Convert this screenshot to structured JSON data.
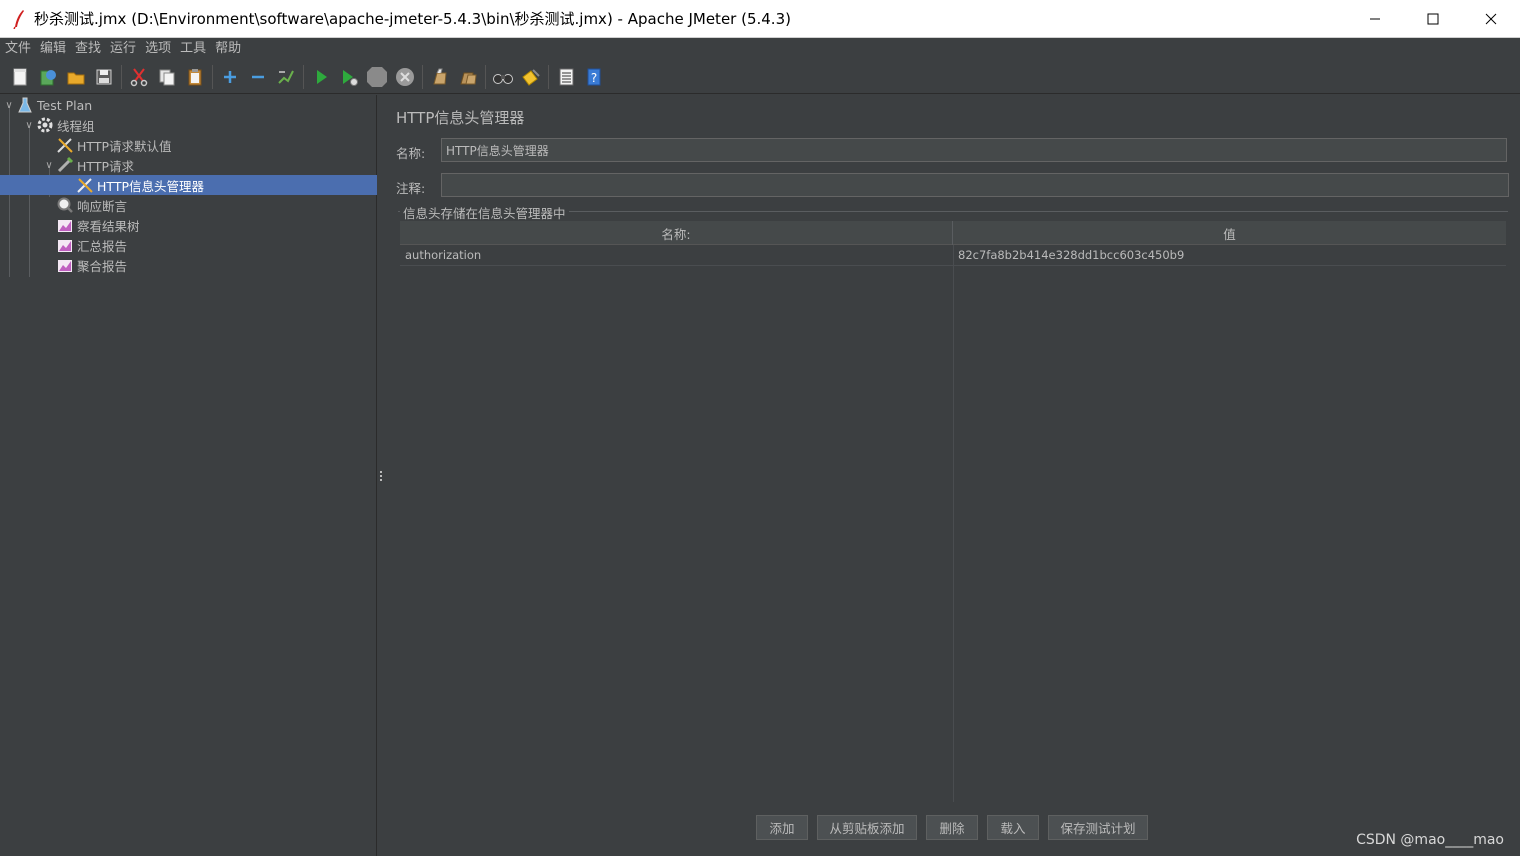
{
  "window": {
    "title": "秒杀测试.jmx (D:\\Environment\\software\\apache-jmeter-5.4.3\\bin\\秒杀测试.jmx) - Apache JMeter (5.4.3)"
  },
  "menu": [
    "文件",
    "编辑",
    "查找",
    "运行",
    "选项",
    "工具",
    "帮助"
  ],
  "toolbar_icons": [
    "new-icon",
    "templates-icon",
    "open-icon",
    "save-icon",
    "cut-icon",
    "copy-icon",
    "paste-icon",
    "expand-icon",
    "collapse-icon",
    "toggle-icon",
    "start-icon",
    "start-no-pause-icon",
    "stop-icon",
    "shutdown-icon",
    "clear-icon",
    "clear-all-icon",
    "search-icon",
    "reset-search-icon",
    "function-helper-icon",
    "help-icon"
  ],
  "tree": {
    "items": [
      {
        "label": "Test Plan",
        "icon": "test-plan-icon"
      },
      {
        "label": "线程组",
        "icon": "thread-group-icon"
      },
      {
        "label": "HTTP请求默认值",
        "icon": "config-element-icon"
      },
      {
        "label": "HTTP请求",
        "icon": "sampler-icon"
      },
      {
        "label": "HTTP信息头管理器",
        "icon": "config-element-icon"
      },
      {
        "label": "响应断言",
        "icon": "assertion-icon"
      },
      {
        "label": "察看结果树",
        "icon": "listener-icon"
      },
      {
        "label": "汇总报告",
        "icon": "listener-icon"
      },
      {
        "label": "聚合报告",
        "icon": "listener-icon"
      }
    ]
  },
  "panel": {
    "title": "HTTP信息头管理器",
    "name_label": "名称:",
    "name_value": "HTTP信息头管理器",
    "comment_label": "注释:",
    "comment_value": "",
    "group_title": "信息头存储在信息头管理器中",
    "table": {
      "headers": [
        "名称:",
        "值"
      ],
      "rows": [
        [
          "authorization",
          "82c7fa8b2b414e328dd1bcc603c450b9"
        ]
      ]
    },
    "buttons": {
      "add": "添加",
      "add_from_clipboard": "从剪贴板添加",
      "delete": "删除",
      "load": "载入",
      "save_test_plan": "保存测试计划"
    }
  },
  "watermark": "CSDN @mao____mao",
  "colors": {
    "background": "#3c3f41",
    "selection": "#4b6eaf",
    "text": "#bbbbbb"
  }
}
